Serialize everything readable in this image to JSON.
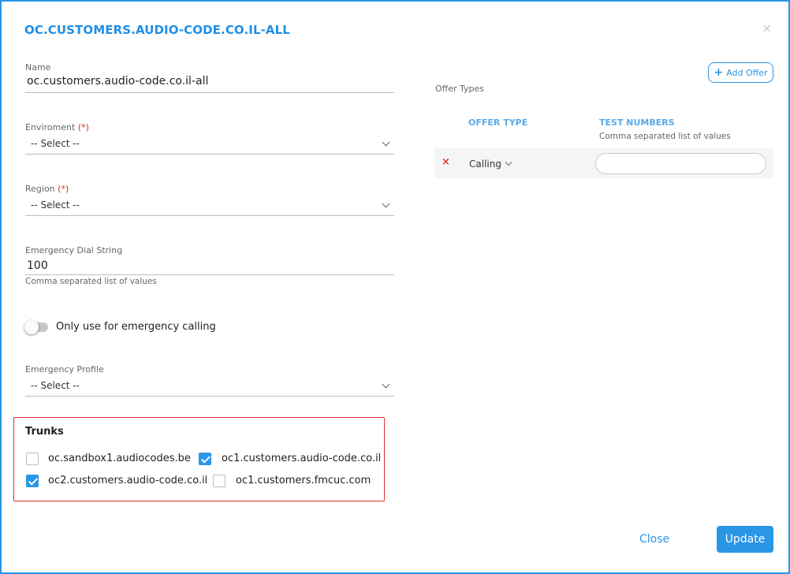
{
  "dialog": {
    "title": "OC.CUSTOMERS.AUDIO-CODE.CO.IL-ALL",
    "close_glyph": "×"
  },
  "form": {
    "name": {
      "label": "Name",
      "value": "oc.customers.audio-code.co.il-all"
    },
    "environment": {
      "label": "Enviroment",
      "required_mark": "(*)",
      "value": "-- Select --"
    },
    "region": {
      "label": "Region",
      "required_mark": "(*)",
      "value": "-- Select --"
    },
    "emergency_dial": {
      "label": "Emergency Dial String",
      "value": "100",
      "hint": "Comma separated list of values"
    },
    "emergency_toggle": {
      "label": "Only use for emergency calling",
      "on": false
    },
    "emergency_profile": {
      "label": "Emergency Profile",
      "value": "-- Select --"
    }
  },
  "trunks": {
    "title": "Trunks",
    "items": [
      {
        "label": "oc.sandbox1.audiocodes.be",
        "checked": false
      },
      {
        "label": "oc1.customers.audio-code.co.il",
        "checked": true
      },
      {
        "label": "oc2.customers.audio-code.co.il",
        "checked": true
      },
      {
        "label": "oc1.customers.fmcuc.com",
        "checked": false
      }
    ]
  },
  "offers": {
    "add_button": "Add Offer",
    "add_icon": "plus-icon",
    "section_label": "Offer Types",
    "columns": {
      "offer_type": "OFFER TYPE",
      "test_numbers": "TEST NUMBERS",
      "test_numbers_hint": "Comma separated list of values"
    },
    "rows": [
      {
        "offer_type": "Calling",
        "test_numbers": "",
        "remove_glyph": "×"
      }
    ]
  },
  "footer": {
    "close": "Close",
    "update": "Update"
  },
  "colors": {
    "accent": "#2b95e6",
    "highlight_border": "#e0312f",
    "required": "#d7281f"
  }
}
